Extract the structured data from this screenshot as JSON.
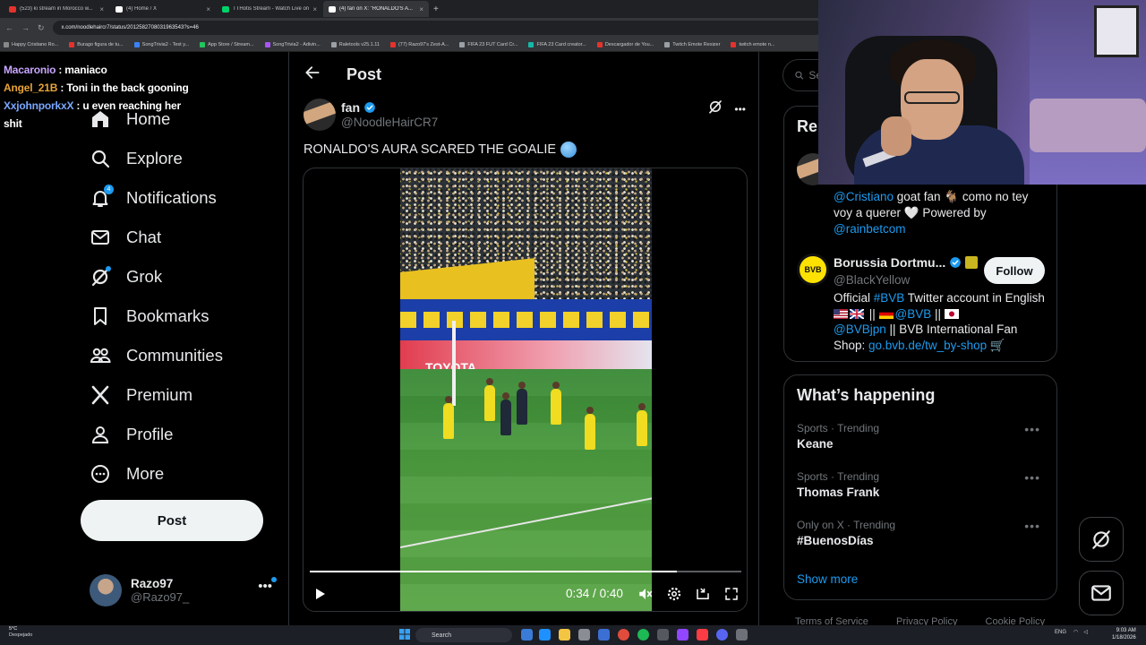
{
  "browser": {
    "tabs": [
      {
        "title": "(523) ki stream in Morocco w...",
        "color": "#e5322d",
        "active": false
      },
      {
        "title": "(4) Home / X",
        "color": "#ffffff",
        "active": false
      },
      {
        "title": "TTHotis Stream - Watch Live on",
        "color": "#00d26a",
        "active": false
      },
      {
        "title": "(4) fan on X: \"RONALDO'S A...",
        "color": "#ffffff",
        "active": true
      }
    ],
    "url": "x.com/noodlehaircr7/status/2012582708031963543?s=46",
    "bookmarks": [
      {
        "label": "Happy Cristiano Ro...",
        "color": "#888888"
      },
      {
        "label": "Burago figura de tu...",
        "color": "#e5322d"
      },
      {
        "label": "SongTrivia2 - Test y...",
        "color": "#3b82f6"
      },
      {
        "label": "App Store / Stream...",
        "color": "#22c55e"
      },
      {
        "label": "SongTrivia2 - Adivin...",
        "color": "#a855f7"
      },
      {
        "label": "Raletools v25.1.11",
        "color": "#9aa0a6"
      },
      {
        "label": "(77) Razo97's Zest-A...",
        "color": "#e5322d"
      },
      {
        "label": "FIFA 23 FUT Card Cr...",
        "color": "#9aa0a6"
      },
      {
        "label": "FIFA 23 Card creator...",
        "color": "#14b8a6"
      },
      {
        "label": "Descargador de You...",
        "color": "#e5322d"
      },
      {
        "label": "Twitch Emote Resizer",
        "color": "#9aa0a6"
      },
      {
        "label": "twitch emote n...",
        "color": "#e5322d"
      }
    ]
  },
  "chat": [
    {
      "user": "Macaronio",
      "color": "#c8a6ff",
      "message": "maniaco"
    },
    {
      "user": "Angel_21B",
      "color": "#e8a33a",
      "message": "Toni in the back gooning"
    },
    {
      "user": "XxjohnporkxX",
      "color": "#7aa7ff",
      "message": "u even reaching her shit"
    }
  ],
  "nav": {
    "items": [
      {
        "label": "Home",
        "icon": "home-icon"
      },
      {
        "label": "Explore",
        "icon": "search-icon"
      },
      {
        "label": "Notifications",
        "icon": "bell-icon",
        "badge": "4"
      },
      {
        "label": "Chat",
        "icon": "mail-icon"
      },
      {
        "label": "Grok",
        "icon": "grok-icon"
      },
      {
        "label": "Bookmarks",
        "icon": "bookmark-icon"
      },
      {
        "label": "Communities",
        "icon": "people-icon"
      },
      {
        "label": "Premium",
        "icon": "x-logo-icon"
      },
      {
        "label": "Profile",
        "icon": "person-icon"
      },
      {
        "label": "More",
        "icon": "more-circle-icon"
      }
    ],
    "post_button": "Post",
    "account": {
      "name": "Razo97",
      "handle": "@Razo97_"
    }
  },
  "post": {
    "header_title": "Post",
    "author_name": "fan",
    "author_handle": "@NoodleHairCR7",
    "text": "RONALDO'S AURA SCARED THE GOALIE",
    "video": {
      "current_time": "0:34",
      "duration": "0:40",
      "separator": "/",
      "progress": 0.85,
      "ad_text": "TOYOTA"
    }
  },
  "sidebar": {
    "search_placeholder": "Se",
    "relevant": {
      "title": "Rel",
      "bio_mention1": "@Cristiano",
      "bio_text": " goat fan 🐐 como no tey voy a querer 🤍 Powered by ",
      "bio_mention2": "@rainbetcom",
      "bvb_logo_text": "BVB",
      "bvb_name": "Borussia Dortmu...",
      "bvb_handle": "@BlackYellow",
      "follow_label": "Follow",
      "bvb_bio_1": "Official ",
      "bvb_tag": "#BVB",
      "bvb_bio_2": " Twitter account in English ",
      "bvb_sep1": " || ",
      "bvb_mention1": "@BVB",
      "bvb_sep2": " || ",
      "bvb_mention2": "@BVBjpn",
      "bvb_bio_3": " || BVB International Fan Shop: ",
      "bvb_link": "go.bvb.de/tw_by-shop",
      "bvb_cart": " 🛒"
    },
    "happening": {
      "title": "What’s happening",
      "trends": [
        {
          "meta": "Sports · Trending",
          "name": "Keane"
        },
        {
          "meta": "Sports · Trending",
          "name": "Thomas Frank"
        },
        {
          "meta": "Only on X · Trending",
          "name": "#BuenosDías"
        }
      ],
      "show_more": "Show more"
    },
    "footer": [
      "Terms of Service",
      "Privacy Policy",
      "Cookie Policy"
    ]
  },
  "taskbar": {
    "weather_temp": "5°C",
    "weather_desc": "Despejado",
    "search_label": "Search",
    "tray_lang": "ENG",
    "time": "9:03 AM",
    "date": "1/18/2026"
  }
}
